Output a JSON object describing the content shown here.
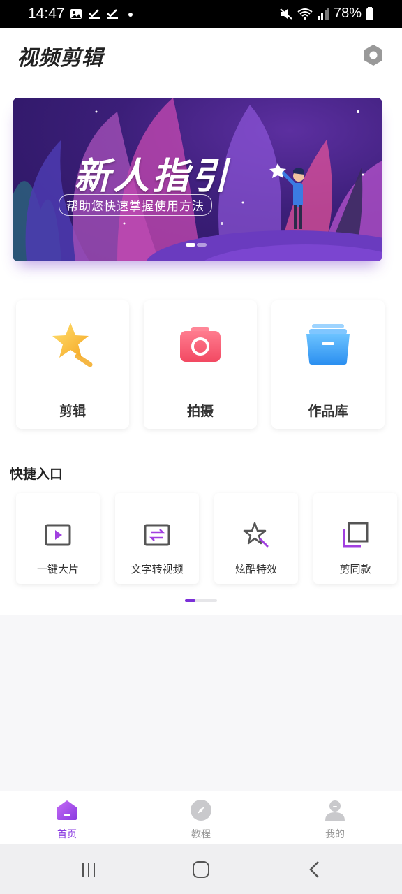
{
  "status_bar": {
    "time": "14:47",
    "battery": "78%",
    "icons": [
      "image-icon",
      "check-icon",
      "check-icon",
      "dot-icon",
      "mute-icon",
      "wifi-icon",
      "signal-icon",
      "battery-icon"
    ]
  },
  "header": {
    "title": "视频剪辑",
    "settings_icon": "hexagon-settings-icon"
  },
  "banner": {
    "title": "新人指引",
    "subtitle": "帮助您快速掌握使用方法",
    "active_dot": 0,
    "dot_count": 2
  },
  "main_actions": [
    {
      "label": "剪辑",
      "icon": "star-wand-icon",
      "color": "#ffc93c"
    },
    {
      "label": "拍摄",
      "icon": "camera-icon",
      "color": "#f7566e"
    },
    {
      "label": "作品库",
      "icon": "folder-box-icon",
      "color": "#3aa6f5"
    }
  ],
  "quick_section": {
    "title": "快捷入口",
    "items": [
      {
        "label": "一键大片",
        "icon": "play-screen-icon"
      },
      {
        "label": "文字转视频",
        "icon": "swap-screen-icon"
      },
      {
        "label": "炫酷特效",
        "icon": "star-effect-icon"
      },
      {
        "label": "剪同款",
        "icon": "copy-layers-icon"
      }
    ],
    "page_indicator": {
      "current": 1,
      "total": 3
    }
  },
  "tab_bar": {
    "active": 0,
    "tabs": [
      {
        "label": "首页",
        "icon": "home-icon"
      },
      {
        "label": "教程",
        "icon": "compass-icon"
      },
      {
        "label": "我的",
        "icon": "user-icon"
      }
    ]
  },
  "system_nav": [
    "recent-apps-icon",
    "home-button-icon",
    "back-icon"
  ],
  "colors": {
    "accent": "#8a3be0",
    "banner_bg": "#3b1e78",
    "inactive": "#9a9a9a"
  }
}
